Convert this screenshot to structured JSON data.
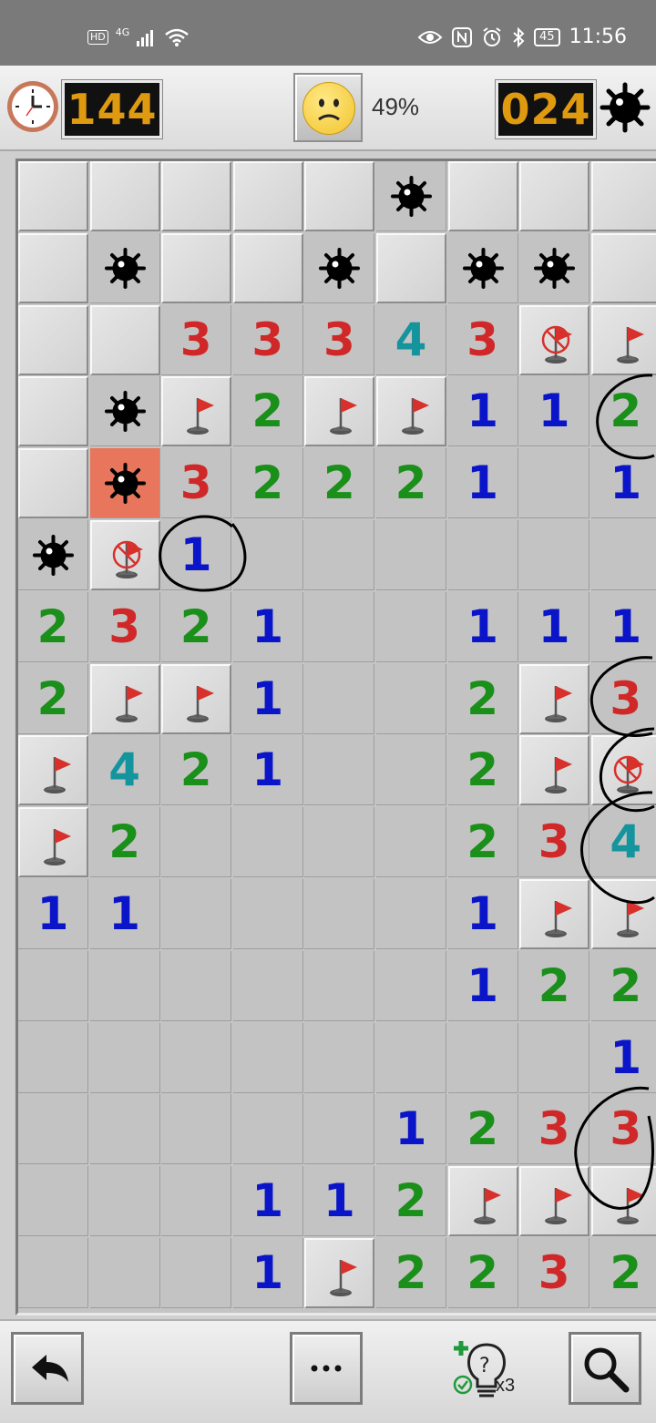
{
  "status_bar": {
    "network_label": "HD",
    "signal_label": "4G",
    "battery": "45",
    "time": "11:56"
  },
  "toolbar": {
    "timer": "144",
    "progress": "49%",
    "mines_left": "024",
    "face": "sad-smiley-icon"
  },
  "board": {
    "cols": 9,
    "rows": 16,
    "legend": {
      "o": "opened empty",
      "c": "unopened",
      "m": "mine",
      "x": "exploded mine",
      "f": "flag",
      "w": "wrong flag",
      "1-8": "number"
    },
    "grid": [
      "ccccc",
      "cmccmcmmc",
      "cc3334313",
      "cm2f2ff11",
      "cx32221o1",
      "mw1oooooo",
      "2321oo111",
      "2ff1oo2f3",
      "f421oo2fw",
      "f2oooo234",
      "11oooo1ff",
      "oooooo122",
      "oooooooo1",
      "oooo1233",
      "ooo112fff",
      "ooo1f2232"
    ],
    "cells": [
      [
        "c",
        "c",
        "c",
        "c",
        "c",
        "m",
        "c",
        "c",
        "c"
      ],
      [
        "c",
        "m",
        "c",
        "c",
        "m",
        "c",
        "m",
        "m",
        "c"
      ],
      [
        "c",
        "c",
        "3",
        "3",
        "3",
        "4",
        "3",
        "w",
        "f"
      ],
      [
        "c",
        "m",
        "f",
        "2",
        "f",
        "f",
        "1",
        "1",
        "2"
      ],
      [
        "c",
        "x",
        "3",
        "2",
        "2",
        "2",
        "1",
        "o",
        "1"
      ],
      [
        "m",
        "w",
        "1",
        "o",
        "o",
        "o",
        "o",
        "o",
        "o"
      ],
      [
        "2",
        "3",
        "2",
        "1",
        "o",
        "o",
        "1",
        "1",
        "1"
      ],
      [
        "2",
        "f",
        "f",
        "1",
        "o",
        "o",
        "2",
        "f",
        "3"
      ],
      [
        "f",
        "4",
        "2",
        "1",
        "o",
        "o",
        "2",
        "f",
        "w"
      ],
      [
        "f",
        "2",
        "o",
        "o",
        "o",
        "o",
        "2",
        "3",
        "4"
      ],
      [
        "1",
        "1",
        "o",
        "o",
        "o",
        "o",
        "1",
        "f",
        "f"
      ],
      [
        "o",
        "o",
        "o",
        "o",
        "o",
        "o",
        "1",
        "2",
        "2"
      ],
      [
        "o",
        "o",
        "o",
        "o",
        "o",
        "o",
        "o",
        "o",
        "1"
      ],
      [
        "o",
        "o",
        "o",
        "o",
        "o",
        "1",
        "2",
        "3",
        "3"
      ],
      [
        "o",
        "o",
        "o",
        "1",
        "1",
        "2",
        "f",
        "f",
        "f"
      ],
      [
        "o",
        "o",
        "o",
        "1",
        "f",
        "2",
        "2",
        "3",
        "2"
      ]
    ],
    "number_colors": {
      "1": "#0a14c8",
      "2": "#1a8f1a",
      "3": "#d02828",
      "4": "#14949c"
    }
  },
  "bottom_bar": {
    "undo": "undo-arrow-icon",
    "menu": "more-dots-icon",
    "hint_count": "x3",
    "zoom": "magnifier-icon"
  }
}
